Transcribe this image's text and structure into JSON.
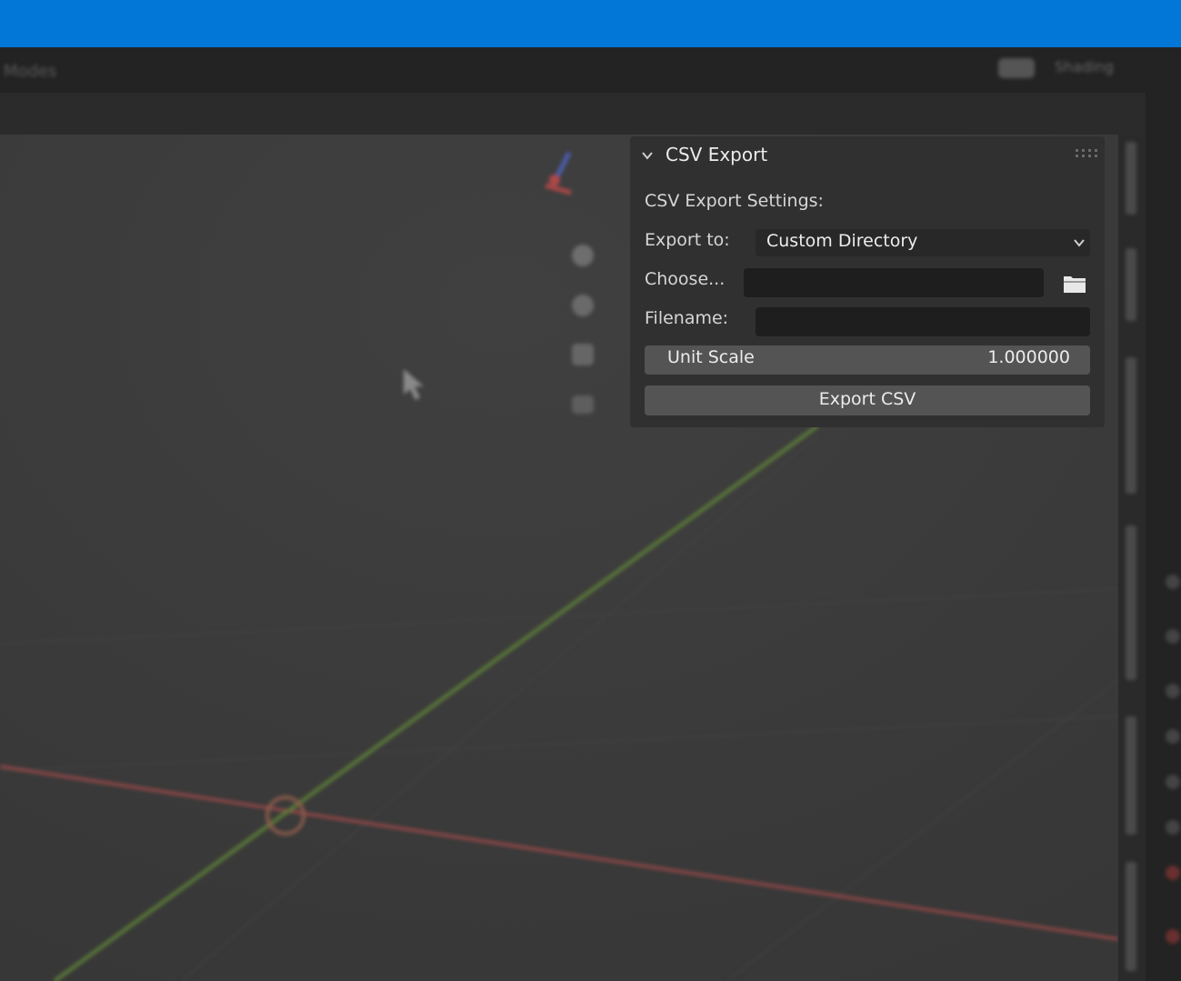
{
  "window": {
    "header_left_text": "Modes",
    "header_right_text": "Shading"
  },
  "panel": {
    "title": "CSV Export",
    "section_label": "CSV Export Settings:",
    "export_to_label": "Export to:",
    "export_to_value": "Custom Directory",
    "choose_label": "Choose...",
    "choose_value": "",
    "filename_label": "Filename:",
    "filename_value": "",
    "unit_scale_label": "Unit Scale",
    "unit_scale_value": "1.000000",
    "export_button_label": "Export CSV"
  },
  "icons": {
    "panel_collapse": "chevron-down-icon",
    "panel_grip": "drag-handle-icon",
    "dropdown": "chevron-down-icon",
    "file_browser": "folder-icon",
    "viewport_tools": [
      "zoom-icon",
      "hand-pan-icon",
      "camera-icon",
      "perspective-toggle-icon"
    ],
    "navigation": "orientation-gizmo-icon"
  },
  "colors": {
    "title_bar": "#0277d8",
    "panel_bg": "#303030",
    "field_bg": "#1e1e1e",
    "button_bg": "#545454",
    "x_axis": "#a04a4a",
    "y_axis": "#5f7f3a"
  }
}
